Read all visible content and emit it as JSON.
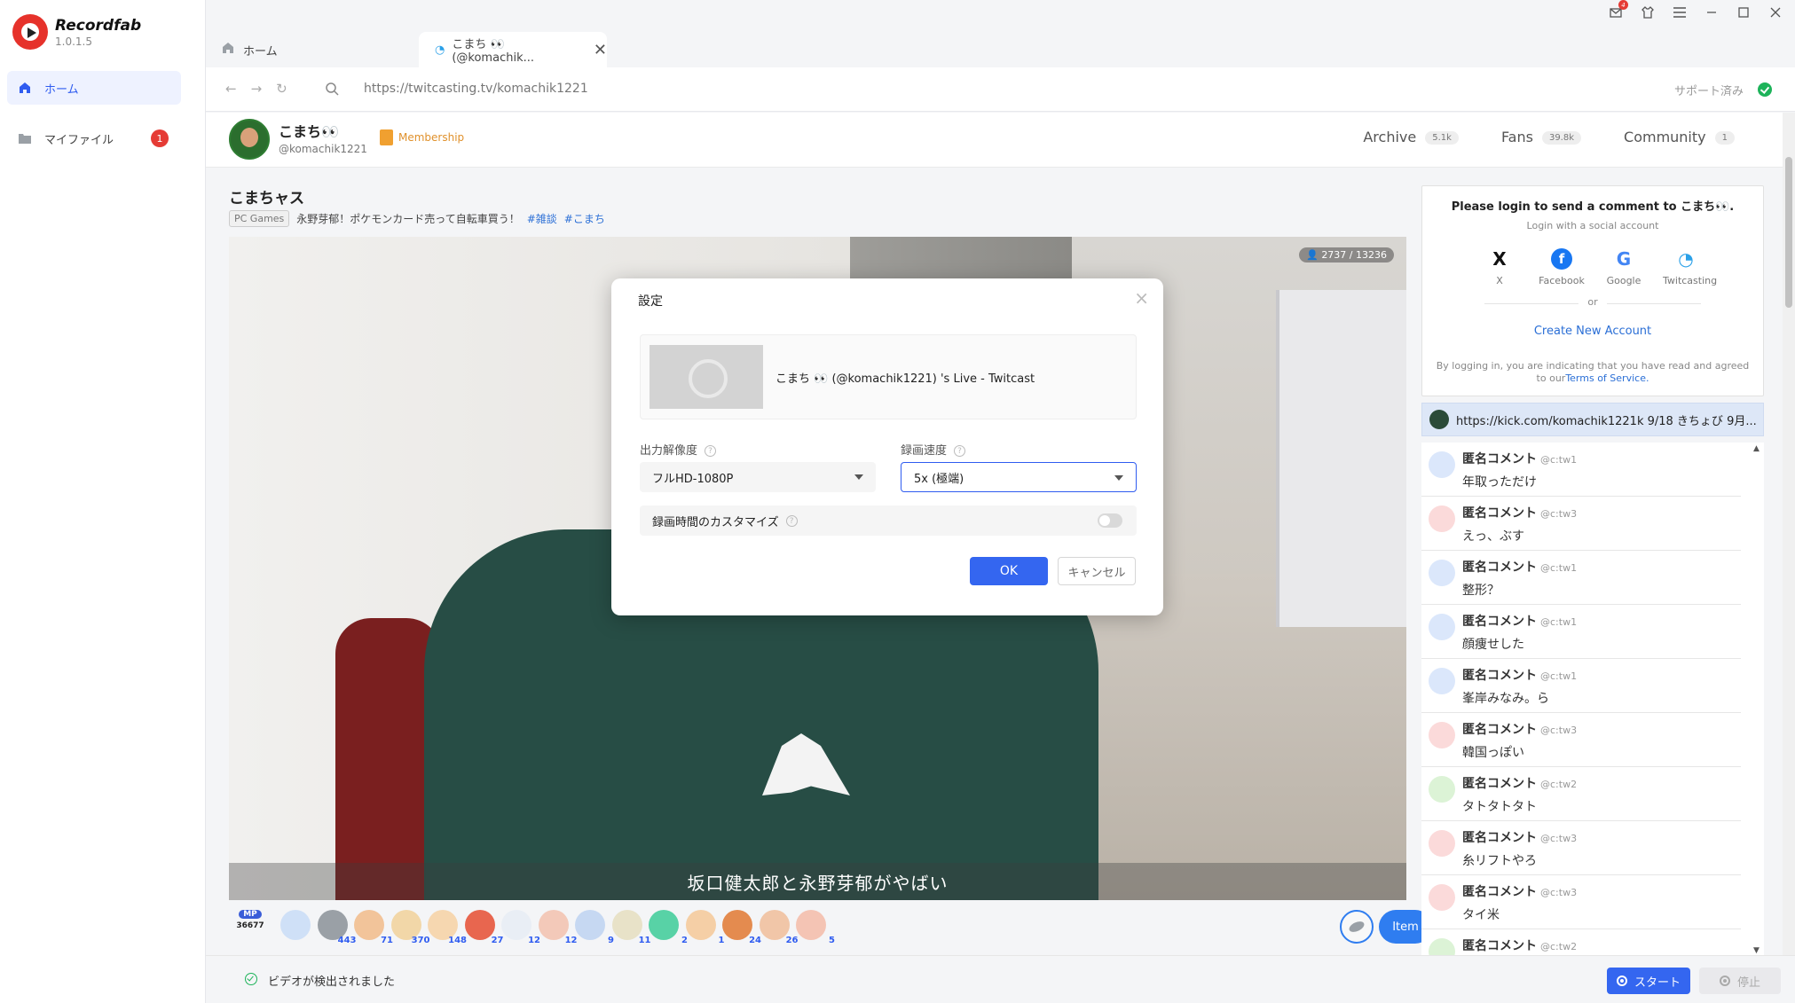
{
  "app": {
    "name": "Recordfab",
    "version": "1.0.1.5"
  },
  "sidebar": {
    "items": [
      {
        "label": "ホーム",
        "icon": "home-icon"
      },
      {
        "label": "マイファイル",
        "icon": "folder-icon",
        "badge": "1"
      }
    ]
  },
  "window": {
    "notification_count": "4"
  },
  "tabs": [
    {
      "label": "ホーム",
      "icon": "home-icon"
    },
    {
      "label": "こまち 👀 (@komachik...",
      "icon": "twitcasting-icon"
    }
  ],
  "address": {
    "url": "https://twitcasting.tv/komachik1221",
    "support_label": "サポート済み"
  },
  "profile": {
    "name": "こまち👀",
    "handle": "@komachik1221",
    "membership_label": "Membership",
    "tabs": [
      {
        "label": "Archive",
        "count": "5.1k"
      },
      {
        "label": "Fans",
        "count": "39.8k"
      },
      {
        "label": "Community",
        "count": "1"
      }
    ]
  },
  "stream": {
    "title": "こまちャス",
    "category": "PC Games",
    "description": "永野芽郁！ポケモンカード売って自転車買う！",
    "hashtags": [
      "#雑談",
      "#こまち"
    ],
    "viewers": "2737 / 13236",
    "subtitle": "坂口健太郎と永野芽郁がやばい"
  },
  "gifts": {
    "mp_label": "MP",
    "mp_value": "36677",
    "items": [
      {
        "count": "",
        "color": "#cfe0f7"
      },
      {
        "count": "443",
        "color": "#9aa0a6"
      },
      {
        "count": "71",
        "color": "#f2c49a"
      },
      {
        "count": "370",
        "color": "#f2d7a8"
      },
      {
        "count": "148",
        "color": "#f6d7b0"
      },
      {
        "count": "27",
        "color": "#e8664f"
      },
      {
        "count": "12",
        "color": "#e9eef5"
      },
      {
        "count": "12",
        "color": "#f3c9b9"
      },
      {
        "count": "9",
        "color": "#c6d8f2"
      },
      {
        "count": "11",
        "color": "#e8e2c8"
      },
      {
        "count": "2",
        "color": "#58d2a6"
      },
      {
        "count": "1",
        "color": "#f5cfa6"
      },
      {
        "count": "24",
        "color": "#e48b4f"
      },
      {
        "count": "26",
        "color": "#f1c6a8"
      },
      {
        "count": "5",
        "color": "#f4c4b4"
      }
    ],
    "item_label": "Item"
  },
  "login": {
    "title": "Please login to send a comment to こまち👀.",
    "subtitle": "Login with a social account",
    "providers": [
      {
        "label": "X",
        "glyph": "X",
        "color": "#111111"
      },
      {
        "label": "Facebook",
        "glyph": "f",
        "color": "#1877f2"
      },
      {
        "label": "Google",
        "glyph": "G",
        "color": "#4285f4"
      },
      {
        "label": "Twitcasting",
        "glyph": "◔",
        "color": "#2aa0e8"
      }
    ],
    "or_label": "or",
    "create_label": "Create New Account",
    "legal_prefix": "By logging in, you are indicating that you have read and agreed to our",
    "tos_label": "Terms of Service."
  },
  "pinned": {
    "text": "https://kick.com/komachik1221k 9/18 きちょび 9月..."
  },
  "comments": [
    {
      "name": "匿名コメント",
      "id": "@c:tw1",
      "text": "年取っただけ",
      "avatar_color": "#dbe7fb"
    },
    {
      "name": "匿名コメント",
      "id": "@c:tw3",
      "text": "えっ、ぶす",
      "avatar_color": "#fbdada"
    },
    {
      "name": "匿名コメント",
      "id": "@c:tw1",
      "text": "整形？",
      "avatar_color": "#dbe7fb"
    },
    {
      "name": "匿名コメント",
      "id": "@c:tw1",
      "text": "顔痩せした",
      "avatar_color": "#dbe7fb"
    },
    {
      "name": "匿名コメント",
      "id": "@c:tw1",
      "text": "峯岸みなみ。ら",
      "avatar_color": "#dbe7fb"
    },
    {
      "name": "匿名コメント",
      "id": "@c:tw3",
      "text": "韓国っぽい",
      "avatar_color": "#fbdada"
    },
    {
      "name": "匿名コメント",
      "id": "@c:tw2",
      "text": "タトタトタト",
      "avatar_color": "#dcf3d6"
    },
    {
      "name": "匿名コメント",
      "id": "@c:tw3",
      "text": "糸リフトやろ",
      "avatar_color": "#fbdada"
    },
    {
      "name": "匿名コメント",
      "id": "@c:tw3",
      "text": "タイ米",
      "avatar_color": "#fbdada"
    },
    {
      "name": "匿名コメント",
      "id": "@c:tw2",
      "text": "",
      "avatar_color": "#dcf3d6"
    }
  ],
  "modal": {
    "title": "設定",
    "live_title": "こまち 👀 (@komachik1221) 's Live - Twitcast",
    "resolution_label": "出力解像度",
    "resolution_value": "フルHD-1080P",
    "speed_label": "録画速度",
    "speed_value": "5x (極端)",
    "custom_time_label": "録画時間のカスタマイズ",
    "ok_label": "OK",
    "cancel_label": "キャンセル"
  },
  "status": {
    "message": "ビデオが検出されました",
    "start_label": "スタート",
    "stop_label": "停止"
  }
}
